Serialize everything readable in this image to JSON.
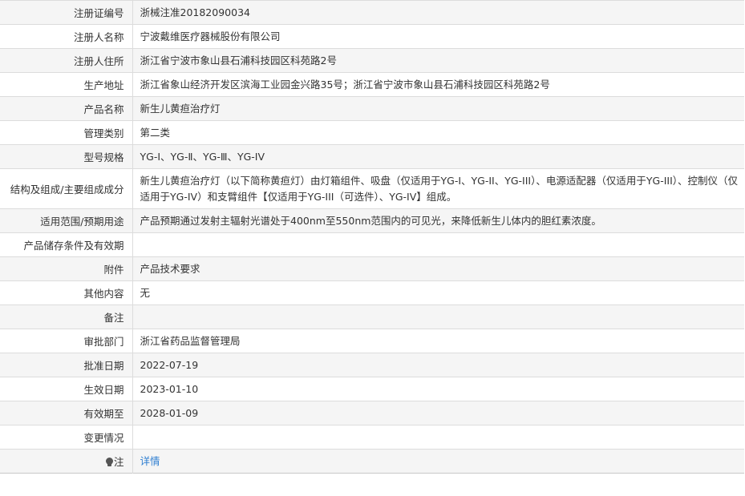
{
  "rows": [
    {
      "label": "注册证编号",
      "value": "浙械注准20182090034"
    },
    {
      "label": "注册人名称",
      "value": "宁波戴维医疗器械股份有限公司"
    },
    {
      "label": "注册人住所",
      "value": "浙江省宁波市象山县石浦科技园区科苑路2号"
    },
    {
      "label": "生产地址",
      "value": "浙江省象山经济开发区滨海工业园金兴路35号；浙江省宁波市象山县石浦科技园区科苑路2号"
    },
    {
      "label": "产品名称",
      "value": "新生儿黄疸治疗灯"
    },
    {
      "label": "管理类别",
      "value": "第二类"
    },
    {
      "label": "型号规格",
      "value": "YG-Ⅰ、YG-Ⅱ、YG-Ⅲ、YG-IV"
    },
    {
      "label": "结构及组成/主要组成成分",
      "value": "新生儿黄疸治疗灯（以下简称黄疸灯）由灯箱组件、吸盘（仅适用于YG-I、YG-II、YG-III）、电源适配器（仅适用于YG-III）、控制仪（仅适用于YG-IV）和支臂组件【仅适用于YG-III（可选件）、YG-IV】组成。"
    },
    {
      "label": "适用范围/预期用途",
      "value": "产品预期通过发射主辐射光谱处于400nm至550nm范围内的可见光，来降低新生儿体内的胆红素浓度。"
    },
    {
      "label": "产品储存条件及有效期",
      "value": ""
    },
    {
      "label": "附件",
      "value": "产品技术要求"
    },
    {
      "label": "其他内容",
      "value": "无"
    },
    {
      "label": "备注",
      "value": ""
    },
    {
      "label": "审批部门",
      "value": "浙江省药品监督管理局"
    },
    {
      "label": "批准日期",
      "value": "2022-07-19"
    },
    {
      "label": "生效日期",
      "value": "2023-01-10"
    },
    {
      "label": "有效期至",
      "value": "2028-01-09"
    },
    {
      "label": "变更情况",
      "value": ""
    }
  ],
  "note_row": {
    "icon": "lightbulb-icon",
    "label": "注",
    "link_text": "详情"
  },
  "colors": {
    "link": "#2f7fd1",
    "row_alt": "#f5f5f5",
    "border": "#dcdcdc",
    "text": "#333333"
  }
}
